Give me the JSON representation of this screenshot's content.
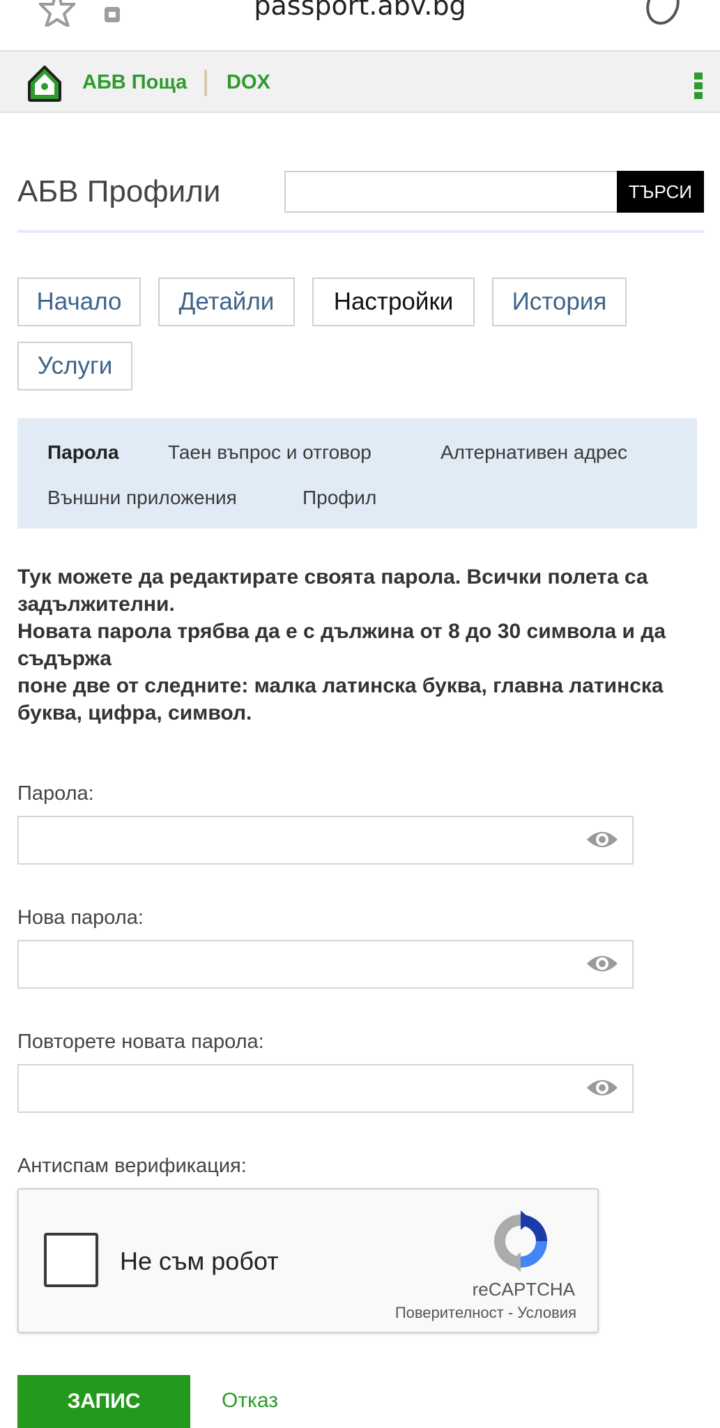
{
  "browser": {
    "url": "passport.abv.bg"
  },
  "topbar": {
    "mail_link": "АБВ Поща",
    "dox_link": "DOX",
    "brand_color": "#2e9b2e"
  },
  "header": {
    "title": "АБВ Профили",
    "search_button": "ТЪРСИ"
  },
  "tabs": [
    {
      "label": "Начало"
    },
    {
      "label": "Детайли"
    },
    {
      "label": "Настройки",
      "active": true
    },
    {
      "label": "История"
    },
    {
      "label": "Услуги"
    }
  ],
  "subnav": [
    {
      "label": "Парола",
      "active": true
    },
    {
      "label": "Таен въпрос и отговор"
    },
    {
      "label": "Алтернативен адрес"
    },
    {
      "label": "Външни приложения"
    },
    {
      "label": "Профил"
    }
  ],
  "info": {
    "line1": "Тук можете да редактирате своята парола. Всички полета са задължителни.",
    "line2": "Новата парола трябва да е с дължина от 8 до 30 символа и да съдържа",
    "line3": "поне две от следните: малка латинска буква, главна латинска буква, цифра, символ."
  },
  "form": {
    "password_label": "Парола:",
    "new_password_label": "Нова парола:",
    "repeat_password_label": "Повторете новата парола:",
    "antispam_label": "Антиспам верификация:"
  },
  "captcha": {
    "checkbox_label": "Не съм робот",
    "brand": "reCAPTCHA",
    "privacy": "Поверителност",
    "separator": "-",
    "terms": "Условия"
  },
  "actions": {
    "save": "ЗАПИС",
    "cancel": "Отказ"
  }
}
